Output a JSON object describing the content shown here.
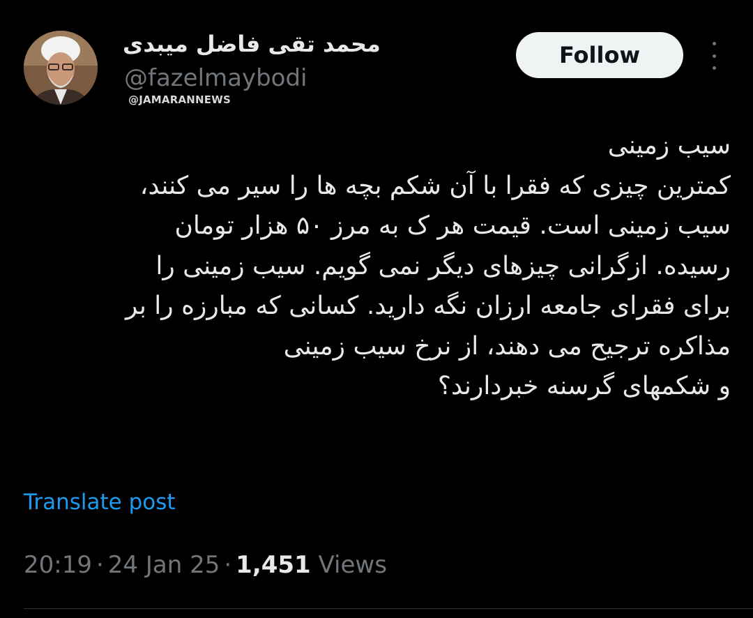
{
  "author": {
    "display_name": "محمد تقی فاضل میبدی",
    "handle": "@fazelmaybodi",
    "avatar_icon": "profile-photo"
  },
  "watermark": "@JAMARANNEWS",
  "follow_label": "Follow",
  "more_icon": "more-vertical-icon",
  "post": {
    "lines": [
      "سیب زمینی",
      "کمترین چیزی که فقرا با آن شکم بچه ها را سیر می کنند،",
      "سیب زمینی است. قیمت هر ک به مرز ۵۰ هزار تومان",
      "رسیده. ازگرانی چیزهای دیگر نمی گویم. سیب زمینی را",
      "برای فقرای جامعه ارزان نگه دارید. کسانی که مبارزه را بر",
      "مذاکره ترجیح می دهند، از نرخ سیب زمینی",
      "و شکمهای گرسنه خبردارند؟"
    ]
  },
  "translate_label": "Translate post",
  "meta": {
    "time": "20:19",
    "date": "24 Jan 25",
    "separator": "·",
    "views_count": "1,451",
    "views_label": "Views"
  },
  "colors": {
    "background": "#000000",
    "text": "#e7e9ea",
    "secondary": "#71767b",
    "link": "#1d9bf0",
    "button_bg": "#eff3f4"
  }
}
